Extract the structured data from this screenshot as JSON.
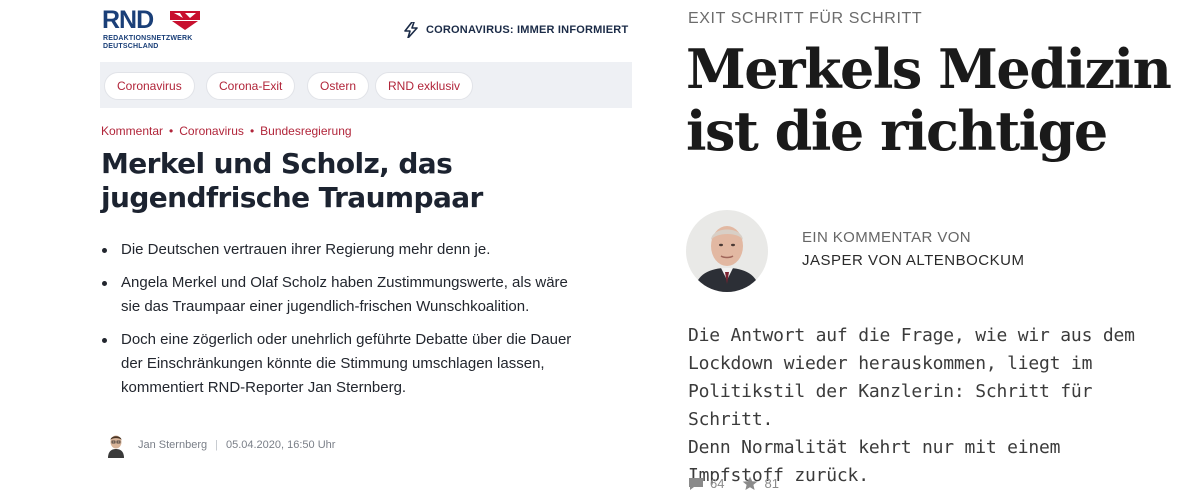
{
  "left": {
    "logo": {
      "brand": "RND",
      "subtitle_line1": "REDAKTIONSNETZWERK",
      "subtitle_line2": "DEUTSCHLAND",
      "mark_color": "#c8102e",
      "brand_color": "#1a3f78"
    },
    "corona_link": "CORONAVIRUS: IMMER INFORMIERT",
    "nav_pills": [
      "Coronavirus",
      "Corona-Exit",
      "Ostern",
      "RND exklusiv"
    ],
    "breadcrumbs": [
      "Kommentar",
      "Coronavirus",
      "Bundesregierung"
    ],
    "headline_line1": "Merkel und Scholz, das",
    "headline_line2": "jugendfrische Traumpaar",
    "bullets": [
      {
        "line1": "Die Deutschen vertrauen ihrer Regierung mehr denn je.",
        "line2": ""
      },
      {
        "line1": "Angela Merkel und Olaf Scholz haben Zustimmungswerte, als wäre",
        "line2": "sie das Traumpaar einer jugendlich-frischen Wunschkoalition."
      },
      {
        "line1": "Doch eine zögerlich oder unehrlich geführte Debatte über die Dauer",
        "line2": "der Einschränkungen könnte die Stimmung umschlagen lassen,",
        "line3": "kommentiert RND-Reporter Jan Sternberg."
      }
    ],
    "author": "Jan Sternberg",
    "date": "05.04.2020, 16:50 Uhr",
    "accent_color": "#b1253a"
  },
  "right": {
    "kicker": "EXIT SCHRITT FÜR SCHRITT",
    "title_line1": "Merkels Medizin",
    "title_line2": "ist die richtige",
    "kommentar_label": "EIN KOMMENTAR VON",
    "kommentar_author": "JASPER VON ALTENBOCKUM",
    "teaser_lines": [
      "Die Antwort auf die Frage, wie wir aus dem",
      "Lockdown wieder herauskommen, liegt im",
      "Politikstil der Kanzlerin: Schritt für Schritt.",
      "Denn Normalität kehrt nur mit einem",
      "Impfstoff zurück."
    ],
    "comments_count": "64",
    "bookmarks_count": "81",
    "icons": {
      "comments": "comment-icon",
      "bookmarks": "star-icon"
    }
  }
}
